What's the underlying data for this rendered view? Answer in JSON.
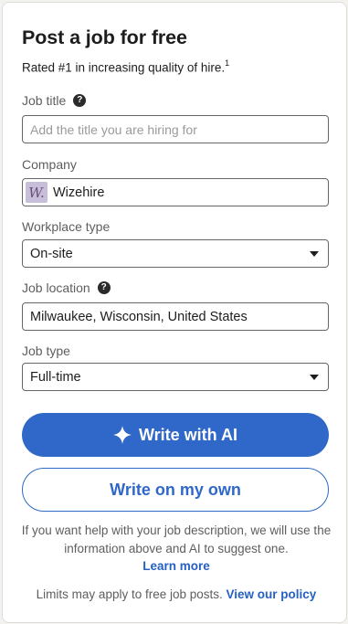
{
  "header": {
    "title": "Post a job for free",
    "subtitle": "Rated #1 in increasing quality of hire.",
    "footnote_mark": "1"
  },
  "form": {
    "job_title": {
      "label": "Job title",
      "placeholder": "Add the title you are hiring for",
      "value": ""
    },
    "company": {
      "label": "Company",
      "value": "Wizehire",
      "logo_letter": "W."
    },
    "workplace_type": {
      "label": "Workplace type",
      "value": "On-site"
    },
    "job_location": {
      "label": "Job location",
      "value": "Milwaukee, Wisconsin, United States"
    },
    "job_type": {
      "label": "Job type",
      "value": "Full-time"
    }
  },
  "actions": {
    "write_ai_label": "Write with AI",
    "write_own_label": "Write on my own"
  },
  "help": {
    "text": "If you want help with your job description, we will use the information above and AI to suggest one.",
    "learn_more": "Learn more"
  },
  "footer": {
    "text": "Limits may apply to free job posts.",
    "link": "View our policy"
  },
  "icons": {
    "help": "question-circle-icon",
    "sparkle": "sparkle-icon",
    "dropdown": "caret-down-icon"
  },
  "colors": {
    "primary": "#2f68c8",
    "link": "#2560c4"
  }
}
